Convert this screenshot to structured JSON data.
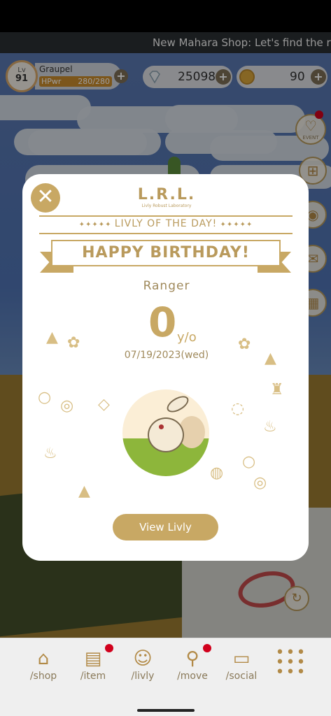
{
  "ticker": {
    "text": "New Mahara Shop: Let's find the rig"
  },
  "hud": {
    "level_label": "Lv",
    "level": "91",
    "player_name": "Graupel",
    "hp_label": "HPwr",
    "hp_value": "280/280",
    "hp_fraction": 1.0,
    "diamonds": "25098",
    "coins": "90",
    "plus": "+"
  },
  "side_icons": [
    {
      "name": "event",
      "label": "EVENT",
      "icon": "balloon-icon"
    },
    {
      "name": "gift",
      "icon": "gift-icon"
    },
    {
      "name": "camera",
      "icon": "camera-icon"
    },
    {
      "name": "mail",
      "icon": "mail-icon"
    },
    {
      "name": "calendar",
      "icon": "calendar-icon"
    }
  ],
  "modal": {
    "close": "✕",
    "logo": "L.R.L.",
    "logo_sub": "Livly Robust Laboratory",
    "livly_of_the_day": "LIVLY OF THE DAY!",
    "banner": "HAPPY BIRTHDAY!",
    "name": "Ranger",
    "age": "0",
    "age_unit": "y/o",
    "date": "07/19/2023(wed)",
    "button": "View Livly"
  },
  "nav": {
    "items": [
      {
        "label": "/shop",
        "icon": "tent-icon",
        "badge": false
      },
      {
        "label": "/item",
        "icon": "chest-icon",
        "badge": true
      },
      {
        "label": "/livly",
        "icon": "livly-face-icon",
        "badge": false
      },
      {
        "label": "/move",
        "icon": "move-icon",
        "badge": true
      },
      {
        "label": "/social",
        "icon": "signboard-icon",
        "badge": false
      },
      {
        "label": "",
        "icon": "grid-menu-icon",
        "badge": false
      }
    ]
  },
  "colors": {
    "gold": "#c8a864",
    "badge_red": "#d1001c"
  }
}
